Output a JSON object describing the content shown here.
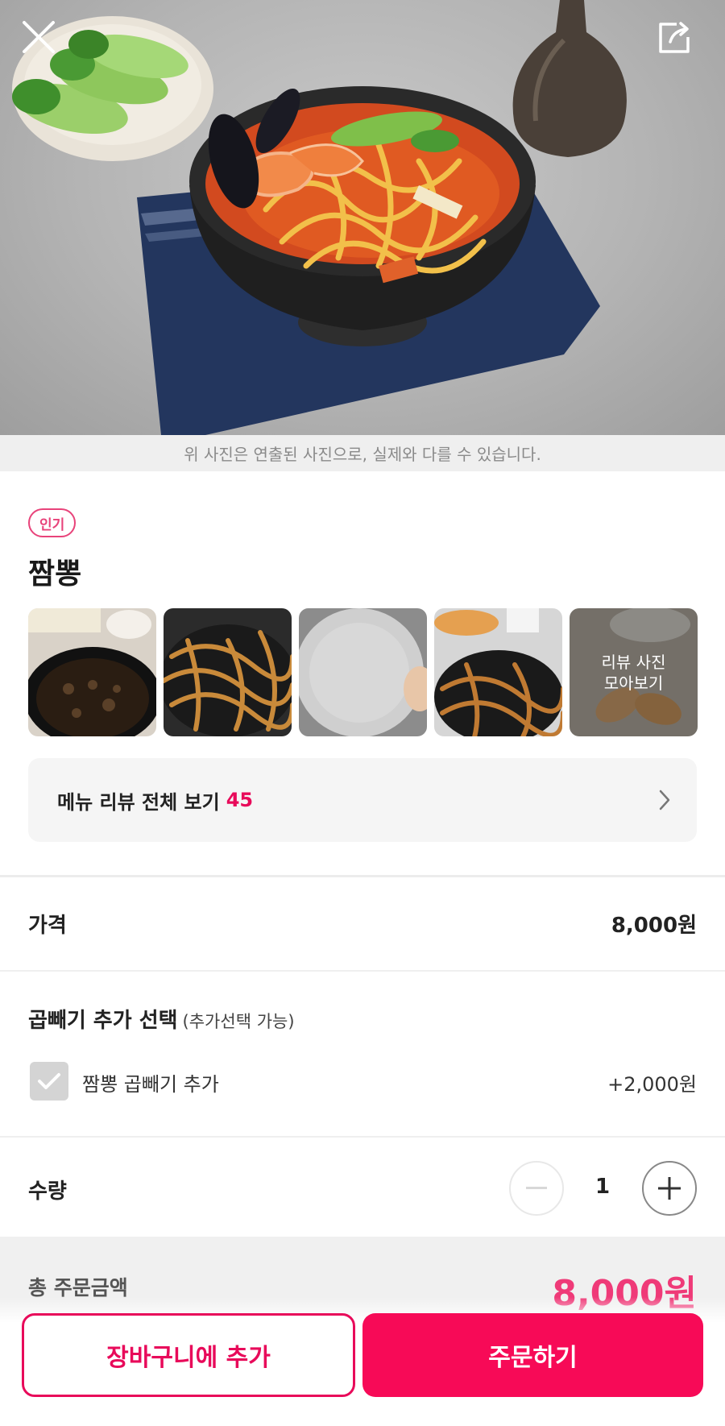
{
  "hero": {
    "photo_notice": "위 사진은 연출된 사진으로, 실제와 다를 수 있습니다.",
    "close_icon": "close-icon",
    "share_icon": "share-icon"
  },
  "menu": {
    "badge": "인기",
    "title": "짬뽕",
    "review_photos_label": "리뷰 사진\n모아보기",
    "review_bar_label": "메뉴 리뷰 전체 보기",
    "review_count": "45"
  },
  "price": {
    "label": "가격",
    "value": "8,000원"
  },
  "option_group": {
    "title": "곱빼기 추가 선택",
    "subtitle": "(추가선택 가능)",
    "options": [
      {
        "name": "짬뽕 곱빼기 추가",
        "price": "+2,000원",
        "checked": false
      }
    ]
  },
  "quantity": {
    "label": "수량",
    "value": "1"
  },
  "total": {
    "label": "총 주문금액",
    "value": "8,000원"
  },
  "actions": {
    "add_to_cart": "장바구니에 추가",
    "order": "주문하기"
  },
  "colors": {
    "accent": "#f70a57",
    "badge": "#e8437a",
    "total": "#ef3a78"
  }
}
